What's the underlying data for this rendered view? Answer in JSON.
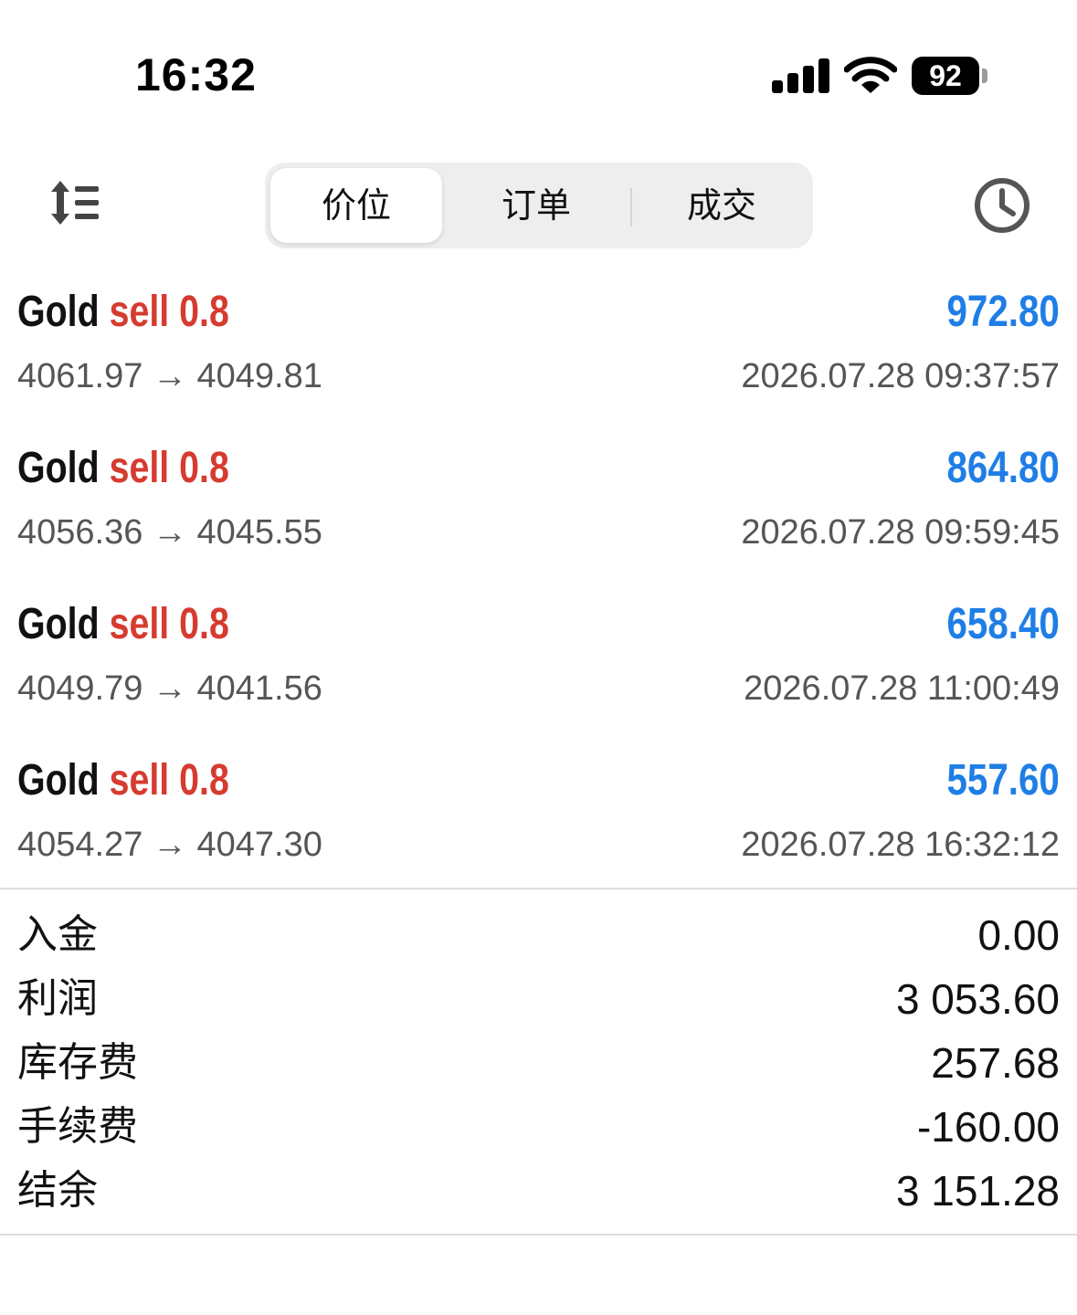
{
  "status_bar": {
    "time": "16:32",
    "battery": "92"
  },
  "toolbar": {
    "tabs": [
      {
        "label": "价位",
        "active": true
      },
      {
        "label": "订单",
        "active": false
      },
      {
        "label": "成交",
        "active": false
      }
    ]
  },
  "deals": [
    {
      "symbol": "Gold",
      "side": "sell",
      "volume": "0.8",
      "profit": "972.80",
      "prices": "4061.97 → 4049.81",
      "time": "2026.07.28 09:37:57"
    },
    {
      "symbol": "Gold",
      "side": "sell",
      "volume": "0.8",
      "profit": "864.80",
      "prices": "4056.36 → 4045.55",
      "time": "2026.07.28 09:59:45"
    },
    {
      "symbol": "Gold",
      "side": "sell",
      "volume": "0.8",
      "profit": "658.40",
      "prices": "4049.79 → 4041.56",
      "time": "2026.07.28 11:00:49"
    },
    {
      "symbol": "Gold",
      "side": "sell",
      "volume": "0.8",
      "profit": "557.60",
      "prices": "4054.27 → 4047.30",
      "time": "2026.07.28 16:32:12"
    }
  ],
  "summary": [
    {
      "label": "入金",
      "value": "0.00"
    },
    {
      "label": "利润",
      "value": "3 053.60"
    },
    {
      "label": "库存费",
      "value": "257.68"
    },
    {
      "label": "手续费",
      "value": "-160.00"
    },
    {
      "label": "结余",
      "value": "3 151.28"
    }
  ],
  "colors": {
    "sell": "#d63b2f",
    "profit": "#1f7ee6",
    "secondary_text": "#555555",
    "segment_bg": "#eeeeef"
  }
}
